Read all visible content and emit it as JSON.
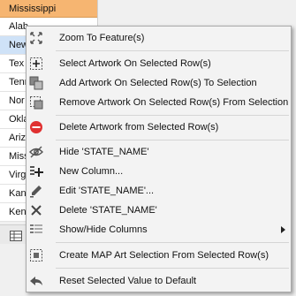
{
  "table": {
    "header": "Mississippi",
    "rows": [
      "Alab",
      "New",
      "Tex",
      "Tenn",
      "Nor",
      "Okla",
      "Ariz",
      "Miss",
      "Virg",
      "Kan",
      "Ken"
    ],
    "selected_row_index": 1
  },
  "menu": {
    "items": [
      {
        "label": "Zoom To Feature(s)",
        "icon": "zoom-to-feature-icon"
      },
      {
        "label": "Select Artwork On Selected Row(s)",
        "icon": "select-artwork-icon"
      },
      {
        "label": "Add Artwork On Selected Row(s) To Selection",
        "icon": "add-artwork-icon"
      },
      {
        "label": "Remove Artwork On Selected Row(s) From Selection",
        "icon": "remove-artwork-icon"
      },
      {
        "label": "Delete Artwork from Selected Row(s)",
        "icon": "delete-artwork-icon"
      },
      {
        "label": "Hide 'STATE_NAME'",
        "icon": "hide-eye-icon"
      },
      {
        "label": "New Column...",
        "icon": "new-column-icon"
      },
      {
        "label": "Edit 'STATE_NAME'...",
        "icon": "edit-pencil-icon"
      },
      {
        "label": "Delete 'STATE_NAME'",
        "icon": "delete-x-icon"
      },
      {
        "label": "Show/Hide Columns",
        "icon": "show-hide-columns-icon",
        "submenu": true
      },
      {
        "label": "Create MAP Art Selection From Selected Row(s)",
        "icon": "map-selection-icon"
      },
      {
        "label": "Reset Selected Value to Default",
        "icon": "reset-arrow-icon"
      }
    ]
  },
  "colors": {
    "header_bg": "#f6b571",
    "selected_row_bg": "#cfe2f7",
    "delete_red": "#e03030",
    "icon_gray": "#555555"
  }
}
